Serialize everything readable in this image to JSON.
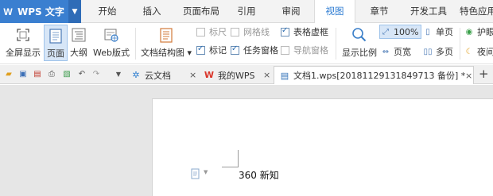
{
  "app": {
    "logo_glyph": "W",
    "title": "WPS 文字",
    "brand_color": "#3a7fd0",
    "dropdown_icon": "chevron-down-icon"
  },
  "menu": {
    "tabs": [
      "开始",
      "插入",
      "页面布局",
      "引用",
      "审阅",
      "视图",
      "章节",
      "开发工具",
      "特色应用"
    ],
    "active_tab": "视图",
    "active_color": "#2a7ad2"
  },
  "ribbon": {
    "fullscreen": "全屏显示",
    "page": "页面",
    "outline": "大纲",
    "web": "Web版式",
    "doc_structure": "文档结构图",
    "ruler": "标尺",
    "gridlines": "网格线",
    "table_gridlines": "表格虚框",
    "mark": "标记",
    "task_pane": "任务窗格",
    "nav_pane": "导航窗格",
    "zoom": "显示比例",
    "zoom_value": "100%",
    "page_width": "页宽",
    "single_page": "单页",
    "multi_page": "多页",
    "eye_protect": "护眼",
    "night": "夜间",
    "checkbox_states": {
      "ruler": false,
      "gridlines": false,
      "table_gridlines": true,
      "mark": true,
      "task_pane": true,
      "nav_pane": false
    }
  },
  "tabs": {
    "cloud": "云文档",
    "mywps": "我的WPS",
    "doc": "文档1.wps[20181129131849713 备份] *",
    "close_glyph": "×",
    "add_glyph": "+"
  },
  "document": {
    "text": "360 新知"
  }
}
